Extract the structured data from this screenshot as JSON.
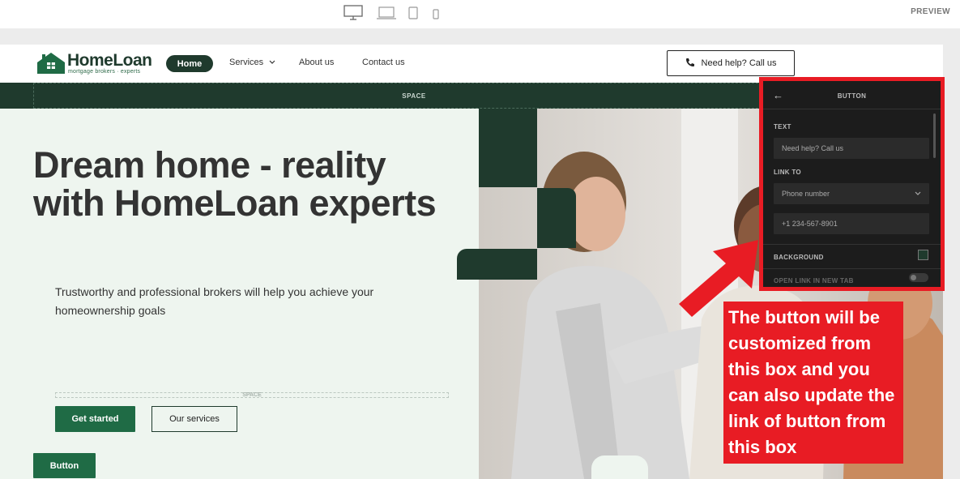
{
  "editor": {
    "preview_label": "PREVIEW",
    "devices": [
      "desktop-icon",
      "laptop-icon",
      "tablet-icon",
      "phone-icon"
    ]
  },
  "navbar": {
    "logo_title": "HomeLoan",
    "logo_sub": "mortgage brokers · experts",
    "home": "Home",
    "services": "Services",
    "about": "About us",
    "contact": "Contact us",
    "cta": "Need help? Call us"
  },
  "space_label": "SPACE",
  "hero": {
    "title": "Dream home - reality with HomeLoan experts",
    "subtitle": "Trustworthy and professional brokers will help you achieve your homeownership goals",
    "space_label": "SPACE",
    "primary_button": "Get started",
    "secondary_button": "Our services",
    "generic_button": "Button"
  },
  "panel": {
    "title": "BUTTON",
    "text_label": "TEXT",
    "text_value": "Need help? Call us",
    "link_label": "LINK TO",
    "link_type": "Phone number",
    "phone_placeholder": "+1 234-567-8901",
    "background_label": "BACKGROUND",
    "new_tab_label": "OPEN LINK IN NEW TAB"
  },
  "annotation": {
    "text": "The button will be customized from this box and you can also update the link of button from this box"
  },
  "colors": {
    "brand_dark": "#1f3a2d",
    "brand_green": "#1f6b45",
    "annotation_red": "#e81c24"
  }
}
